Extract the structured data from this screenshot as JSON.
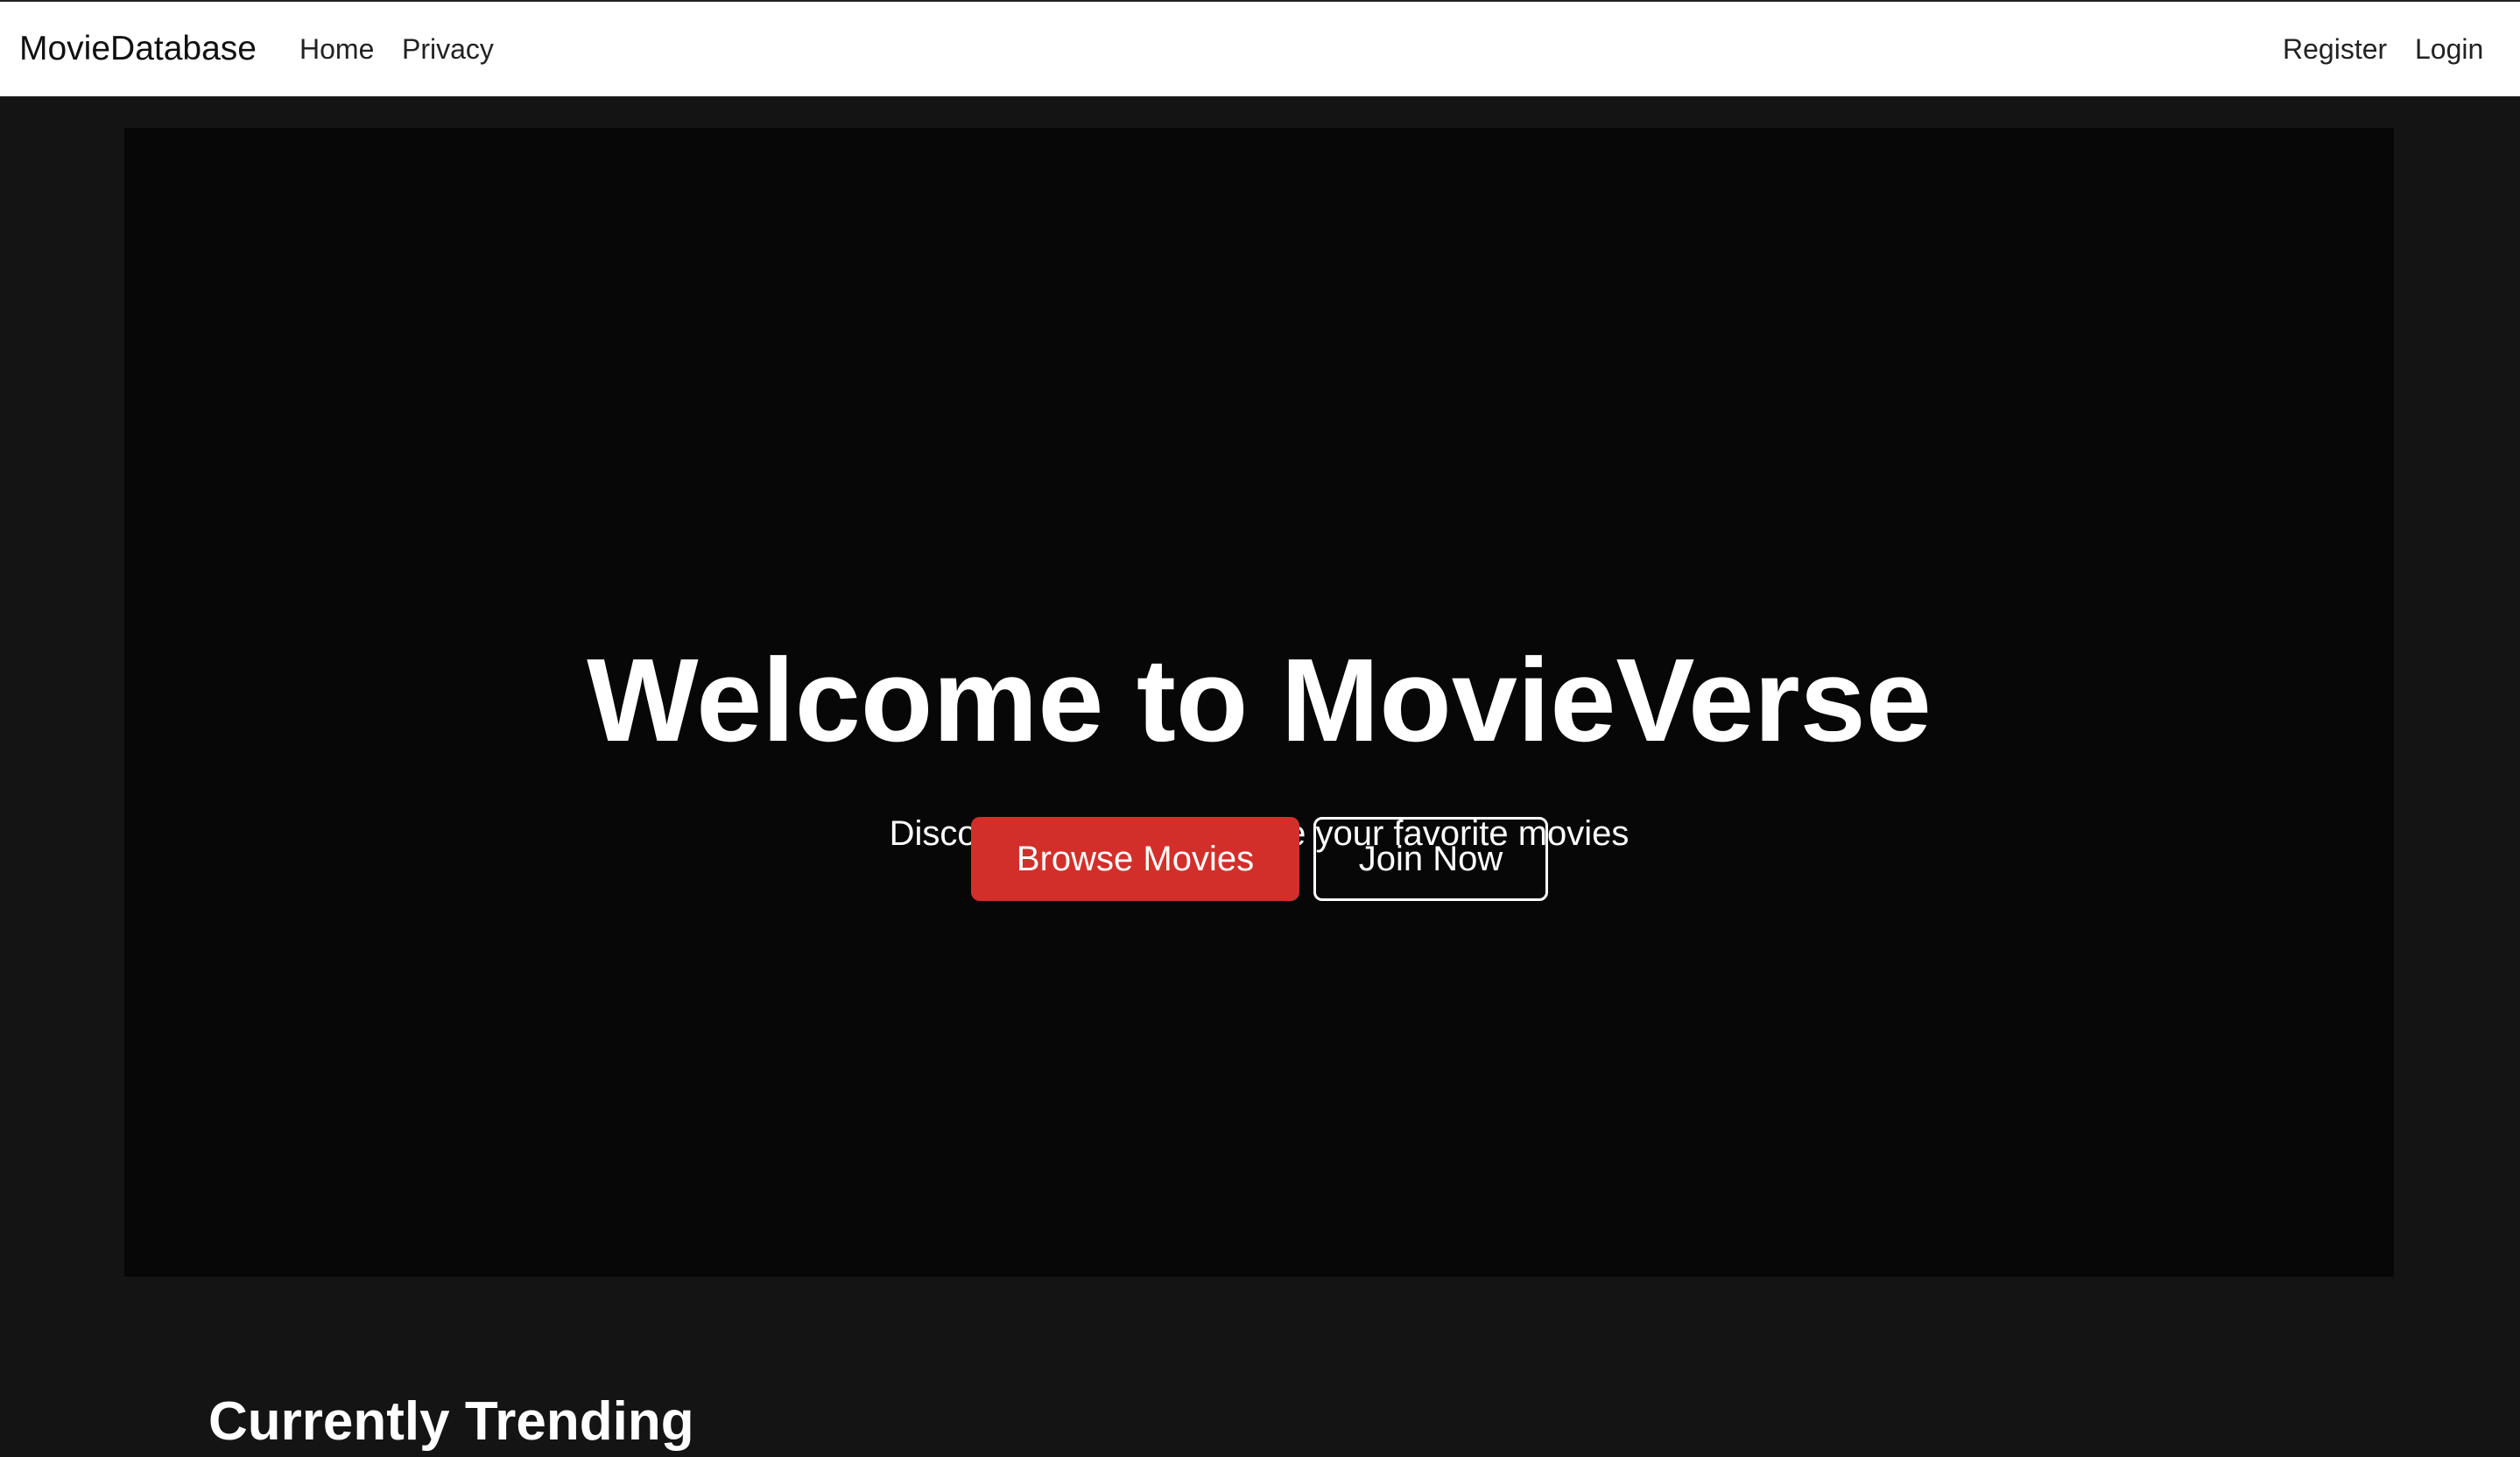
{
  "navbar": {
    "brand": "MovieDatabase",
    "links": [
      {
        "label": "Home"
      },
      {
        "label": "Privacy"
      }
    ],
    "right_links": [
      {
        "label": "Register"
      },
      {
        "label": "Login"
      }
    ]
  },
  "hero": {
    "title": "Welcome to MovieVerse",
    "subtitle": "Discover, explore, and rate your favorite movies",
    "primary_button": "Browse Movies",
    "secondary_button": "Join Now"
  },
  "trending": {
    "heading": "Currently Trending"
  },
  "colors": {
    "accent": "#d32f2a",
    "page_background": "#141414",
    "hero_background": "#070707",
    "navbar_background": "#ffffff"
  }
}
